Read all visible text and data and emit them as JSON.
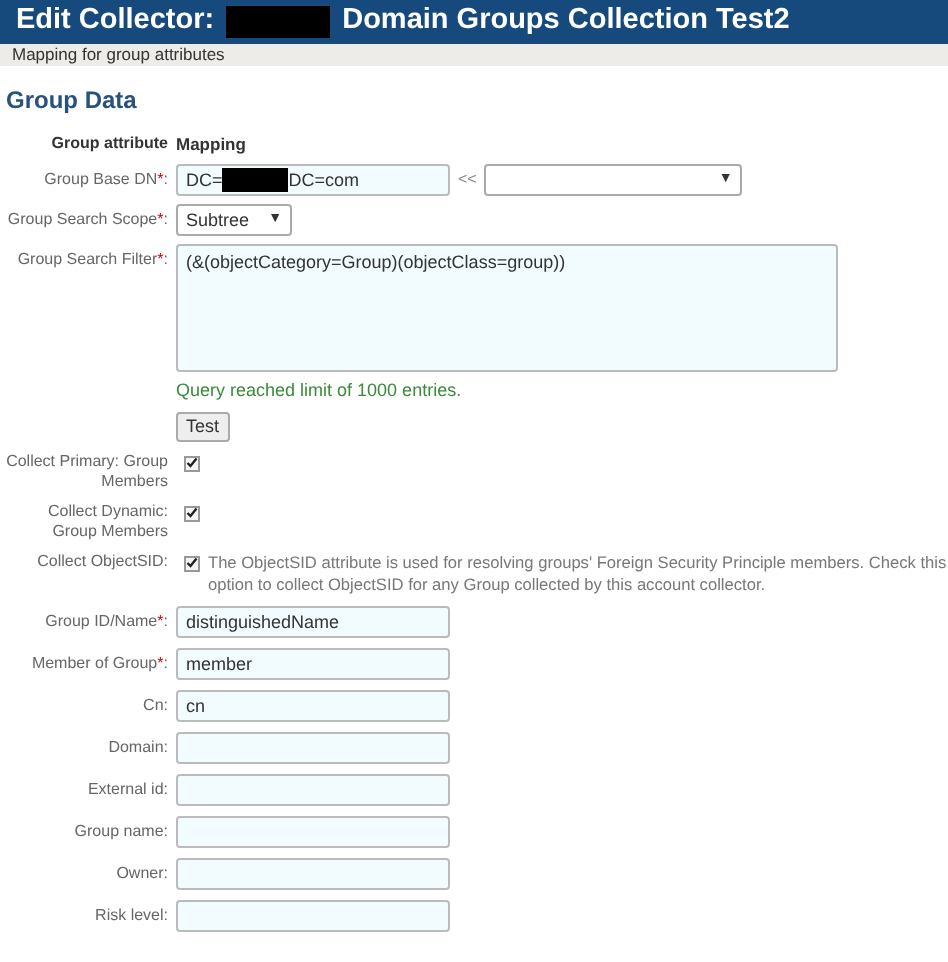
{
  "header": {
    "title_prefix": "Edit Collector:",
    "redacted": true,
    "title": "Domain Groups Collection Test2"
  },
  "subtitle": "Mapping for group attributes",
  "section_title": "Group Data",
  "columns": [
    "Group attribute",
    "Mapping"
  ],
  "rows": [
    {
      "kind": "dn",
      "label": "Group Base DN",
      "required_mark": "*",
      "colon": ":",
      "value_start": "DC=",
      "value_end": "DC=com",
      "redacted": true,
      "separator": "<<",
      "caret": "▼"
    },
    {
      "kind": "select",
      "label": "Group Search Scope",
      "required_mark": "*",
      "colon": ":",
      "value": "Subtree",
      "caret": "▼"
    },
    {
      "kind": "textarea",
      "label": "Group Search Filter",
      "required_mark": "*",
      "colon": ":",
      "value": "(&(objectCategory=Group)(objectClass=group))",
      "message": "Query reached limit of 1000 entries.",
      "button": "Test"
    },
    {
      "kind": "checkbox",
      "label": "Collect Primary: Group Members",
      "checked": true
    },
    {
      "kind": "checkbox",
      "label": "Collect Dynamic: Group Members",
      "checked": true
    },
    {
      "kind": "checkbox",
      "label": "Collect ObjectSID:",
      "checked": true,
      "description": "The ObjectSID attribute is used for resolving groups' Foreign Security Principle members. Check this option to collect ObjectSID for any Group collected by this account collector."
    },
    {
      "kind": "text",
      "label": "Group ID/Name",
      "required_mark": "*",
      "colon": ":",
      "value": "distinguishedName"
    },
    {
      "kind": "text",
      "label": "Member of Group",
      "required_mark": "*",
      "colon": ":",
      "value": "member"
    },
    {
      "kind": "text",
      "label": "Cn:",
      "value": "cn"
    },
    {
      "kind": "text",
      "label": "Domain:"
    },
    {
      "kind": "text",
      "label": "External id:"
    },
    {
      "kind": "text",
      "label": "Group name:"
    },
    {
      "kind": "text",
      "label": "Owner:"
    },
    {
      "kind": "text",
      "label": "Risk level:"
    }
  ]
}
